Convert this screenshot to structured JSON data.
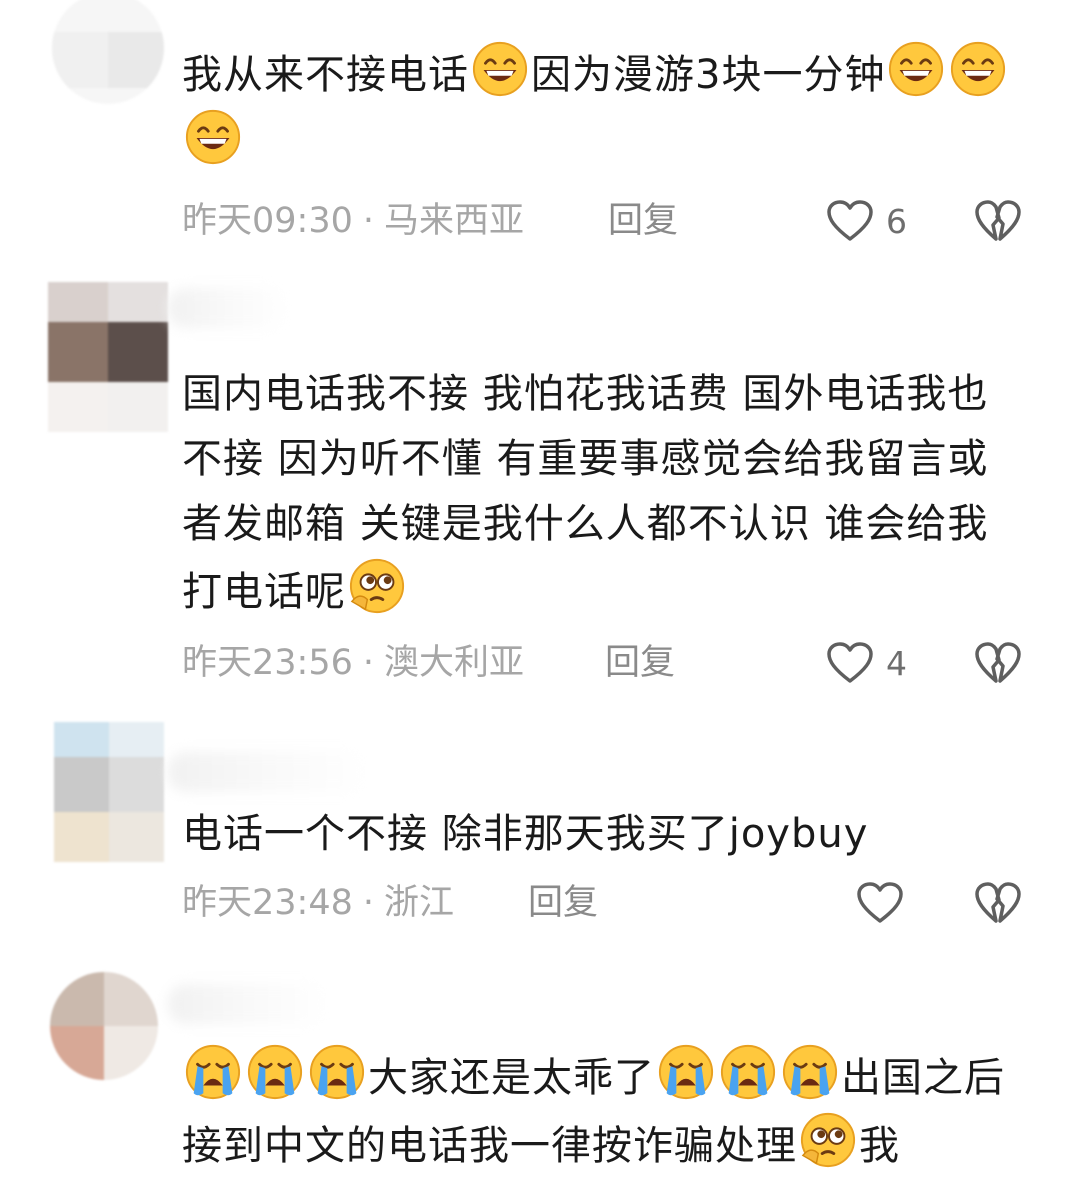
{
  "comments": [
    {
      "segments": [
        {
          "t": "text",
          "v": "我从来不接电话"
        },
        {
          "t": "emoji",
          "v": "grin-emoji"
        },
        {
          "t": "text",
          "v": "因为漫游3块一分钟"
        },
        {
          "t": "emoji",
          "v": "grin-emoji"
        },
        {
          "t": "emoji",
          "v": "grin-emoji"
        },
        {
          "t": "emoji",
          "v": "grin-emoji"
        }
      ],
      "time": "昨天09:30",
      "location": "马来西亚",
      "reply_label": "回复",
      "likes": "6"
    },
    {
      "segments": [
        {
          "t": "text",
          "v": "国内电话我不接 我怕花我话费 国外电话我也不接 因为听不懂 有重要事感觉会给我留言或者发邮箱 关键是我什么人都不认识 谁会给我打电话呢"
        },
        {
          "t": "emoji",
          "v": "pleading-emoji"
        }
      ],
      "time": "昨天23:56",
      "location": "澳大利亚",
      "reply_label": "回复",
      "likes": "4"
    },
    {
      "segments": [
        {
          "t": "text",
          "v": "电话一个不接 除非那天我买了joybuy"
        }
      ],
      "time": "昨天23:48",
      "location": "浙江",
      "reply_label": "回复",
      "likes": ""
    },
    {
      "segments": [
        {
          "t": "emoji",
          "v": "crying-emoji"
        },
        {
          "t": "emoji",
          "v": "crying-emoji"
        },
        {
          "t": "emoji",
          "v": "crying-emoji"
        },
        {
          "t": "text",
          "v": "大家还是太乖了"
        },
        {
          "t": "emoji",
          "v": "crying-emoji"
        },
        {
          "t": "emoji",
          "v": "crying-emoji"
        },
        {
          "t": "emoji",
          "v": "crying-emoji"
        },
        {
          "t": "text",
          "v": "出国之后接到中文的电话我一律按诈骗处理"
        },
        {
          "t": "emoji",
          "v": "pleading-emoji"
        },
        {
          "t": "text",
          "v": "我"
        }
      ],
      "time": "",
      "location": "",
      "reply_label": "",
      "likes": ""
    }
  ],
  "meta_separator": "·",
  "icons": {
    "like": "heart-outline-icon",
    "dislike": "broken-heart-icon"
  },
  "colors": {
    "text": "#1a1a1a",
    "meta": "#a6a6a6",
    "reply": "#8a8a8a",
    "emoji_face": "#ffc83d",
    "emoji_cry": "#4aa3f0"
  }
}
